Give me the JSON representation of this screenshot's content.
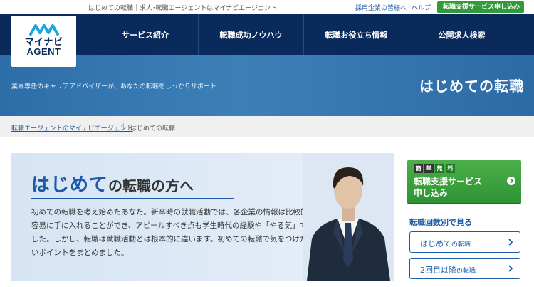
{
  "utility": {
    "tagline": "はじめての転職｜求人･転職エージェントはマイナビエージェント",
    "employer_link": "採用企業の皆様へ",
    "help_link": "ヘルプ",
    "cta": "転職支援サービス申し込み"
  },
  "logo": {
    "line1": "マイナビ",
    "line2": "AGENT"
  },
  "nav": {
    "items": [
      {
        "label": "サービス紹介"
      },
      {
        "label": "転職成功ノウハウ"
      },
      {
        "label": "転職お役立ち情報"
      },
      {
        "label": "公開求人検索"
      }
    ]
  },
  "hero": {
    "subtitle": "業界専任のキャリアアドバイザーが、あなたの転職をしっかりサポート",
    "title": "はじめての転職"
  },
  "breadcrumb": {
    "home": "転職エージェントのマイナビエージェント",
    "separator": "|",
    "current": "はじめての転職"
  },
  "visual": {
    "title_highlight": "はじめて",
    "title_rest": "の転職の方へ",
    "body": "初めての転職を考え始めたあなた。新卒時の就職活動では、各企業の情報は比較的容易に手に入れることができ、アピールすべき点も学生時代の経験や「やる気」でした。しかし、転職は就職活動とは根本的に違います。初めての転職で気をつけたいポイントをまとめました。"
  },
  "sidebar": {
    "cta": {
      "tags": [
        "簡",
        "単",
        "無",
        "料"
      ],
      "line1": "転職支援サービス",
      "line2": "申し込み"
    },
    "heading": "転職回数別で見る",
    "buttons": [
      {
        "main": "はじめて",
        "suffix": "の転職"
      },
      {
        "main": "2回目以降",
        "suffix": "の転職"
      }
    ]
  },
  "colors": {
    "navy": "#0a2a5c",
    "hero_blue": "#3d80b8",
    "accent_blue": "#1d5aa8",
    "cta_green": "#2f9c38"
  }
}
